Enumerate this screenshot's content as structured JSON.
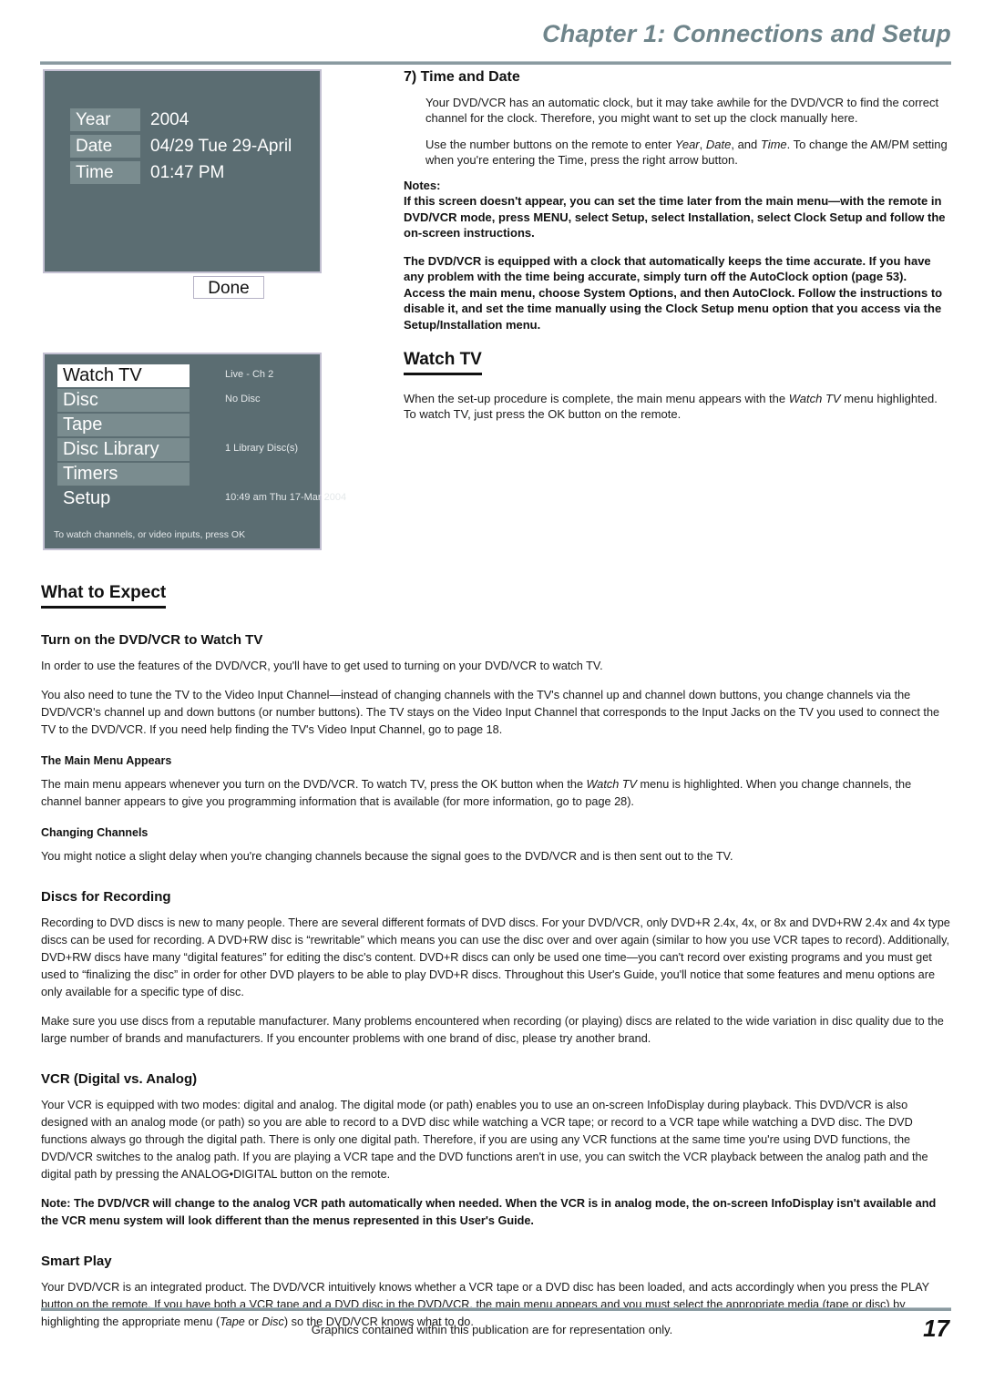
{
  "header": {
    "chapter_title": "Chapter 1: Connections and Setup"
  },
  "screenshot_clock": {
    "rows": [
      {
        "label": "Year",
        "value": "2004"
      },
      {
        "label": "Date",
        "value": "04/29 Tue 29-April"
      },
      {
        "label": "Time",
        "value": "01:47 PM"
      }
    ],
    "done_label": "Done"
  },
  "screenshot_menu": {
    "items": [
      {
        "label": "Watch TV",
        "selected": true
      },
      {
        "label": "Disc",
        "selected": false
      },
      {
        "label": "Tape",
        "selected": false
      },
      {
        "label": "Disc Library",
        "selected": false
      },
      {
        "label": "Timers",
        "selected": false
      },
      {
        "label": "Setup",
        "selected": false
      }
    ],
    "status": {
      "live_channel": "Live - Ch 2",
      "disc_state": "No Disc",
      "library_count": "1 Library Disc(s)",
      "clock": "10:49 am Thu 17-Mar 2004"
    },
    "hint": "To watch channels, or video inputs, press OK"
  },
  "section_time_date": {
    "heading": "7) Time and Date",
    "p1": "Your DVD/VCR has an automatic clock, but it may take awhile for the DVD/VCR to find the correct channel for the clock. Therefore, you might want to set up the clock manually here.",
    "p2_a": "Use the number buttons on the remote to enter ",
    "p2_em1": "Year",
    "p2_b": ", ",
    "p2_em2": "Date",
    "p2_c": ", and ",
    "p2_em3": "Time",
    "p2_d": ". To change the AM/PM setting when you're entering the Time, press the right arrow button.",
    "notes_label": "Notes:",
    "note1": "If this screen doesn't appear, you can set the time later from the main menu—with the remote in DVD/VCR mode, press MENU, select Setup, select Installation, select Clock Setup and follow the on-screen instructions.",
    "note2": "The DVD/VCR is equipped with a clock that automatically keeps the time accurate. If you have any problem with the time being accurate, simply turn off the AutoClock option (page 53). Access the main menu, choose System Options, and then AutoClock. Follow the instructions to disable it, and set the time manually using the Clock Setup menu option that you access via the Setup/Installation menu."
  },
  "section_watch_tv": {
    "heading": "Watch TV",
    "p1_a": "When the set-up procedure is complete, the main menu appears with the ",
    "p1_em": "Watch TV",
    "p1_b": " menu highlighted. To watch TV, just press the OK button on the remote."
  },
  "section_what_to_expect": {
    "heading": "What to Expect",
    "turn_on_head": "Turn on the DVD/VCR to Watch TV",
    "turn_on_p1": "In order to use the features of the DVD/VCR, you'll have to get used to turning on your DVD/VCR to watch TV.",
    "turn_on_p2": "You also need to tune the TV to the Video Input Channel—instead of changing channels with the TV's channel up and channel down buttons, you change channels via the DVD/VCR's channel up and down buttons (or number buttons). The TV stays on the Video Input Channel that corresponds to the Input Jacks on the TV you used to connect the TV to the DVD/VCR. If you need help finding the TV's Video Input Channel, go to page 18.",
    "main_menu_head": "The Main Menu Appears",
    "main_menu_p_a": "The main menu appears whenever you turn on the DVD/VCR. To watch TV, press the OK button when the ",
    "main_menu_p_em": "Watch TV",
    "main_menu_p_b": " menu is highlighted. When you change channels, the channel banner appears to give you programming information that is available (for more information, go to page 28).",
    "changing_head": "Changing Channels",
    "changing_p": "You might notice a slight delay when you're changing channels because the signal goes to the DVD/VCR and is then sent out to the TV."
  },
  "section_discs": {
    "heading": "Discs for Recording",
    "p1": "Recording to DVD discs is new to many people. There are several different formats of DVD discs. For your DVD/VCR, only DVD+R 2.4x, 4x, or 8x and DVD+RW 2.4x and 4x type discs can be used for recording. A DVD+RW disc is “rewritable” which means you can use the disc over and over again (similar to how you use VCR tapes to record). Additionally, DVD+RW discs have many “digital features” for editing the disc's content. DVD+R discs can only be used one time—you can't record over existing programs and you must get used to “finalizing the disc” in order for other DVD players to be able to play DVD+R discs. Throughout this User's Guide, you'll notice that some features and menu options are only available for a specific type of disc.",
    "p2": "Make sure you use discs from a reputable manufacturer. Many problems encountered when recording (or playing) discs are related to the wide variation in disc quality due to the large number of brands and manufacturers. If you encounter problems with one brand of disc, please try another brand."
  },
  "section_vcr": {
    "heading": "VCR (Digital vs. Analog)",
    "p1": "Your VCR is equipped with two modes: digital and analog. The digital mode (or path) enables you to use an on-screen InfoDisplay during playback. This DVD/VCR is also designed with an analog mode (or path) so you are able to record to a DVD disc while watching a VCR tape; or record to a VCR tape while watching a DVD disc. The DVD functions always go through the digital path. There is only one digital path. Therefore, if you are using any VCR functions at the same time you're using DVD functions, the DVD/VCR switches to the analog path. If you are playing a VCR tape and the DVD functions aren't in use, you can switch the VCR playback between the analog path and the digital path by pressing the ANALOG•DIGITAL button on the remote.",
    "note": "Note: The DVD/VCR will change to the analog VCR path automatically when needed. When the VCR is in analog mode, the on-screen InfoDisplay isn't available and the VCR menu system will look different than the menus represented in this User's Guide."
  },
  "section_smart_play": {
    "heading": "Smart Play",
    "p1_a": "Your DVD/VCR is an integrated product. The DVD/VCR intuitively knows whether a VCR tape or a DVD disc has been loaded, and acts accordingly when you press the PLAY button on the remote. If you have both a VCR tape and a DVD disc in the DVD/VCR, the main menu appears and you must select the appropriate media (tape or disc) by highlighting the appropriate menu (",
    "p1_em1": "Tape",
    "p1_mid": " or ",
    "p1_em2": "Disc",
    "p1_b": ") so the DVD/VCR knows what to do."
  },
  "footer": {
    "note": "Graphics contained within this publication are for representation only.",
    "page_number": "17"
  }
}
